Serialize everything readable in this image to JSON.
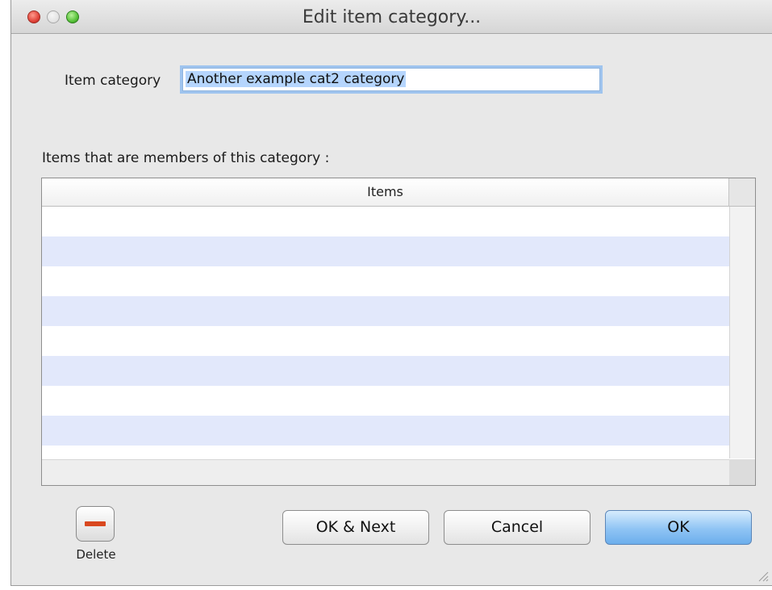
{
  "window": {
    "title": "Edit item category..."
  },
  "form": {
    "category_label": "Item category",
    "category_value": "Another example cat2 category",
    "members_label": "Items that are members of this category :"
  },
  "table": {
    "header": "Items",
    "rows": [
      "",
      "",
      "",
      "",
      "",
      "",
      "",
      ""
    ]
  },
  "buttons": {
    "delete_label": "Delete",
    "ok_next": "OK & Next",
    "cancel": "Cancel",
    "ok": "OK"
  },
  "colors": {
    "close": "#e0443a",
    "zoom": "#58c23a",
    "row_stripe": "#e2e8fb",
    "default_button": "#8fc4f4",
    "delete_minus": "#d9481f"
  },
  "icons": [
    "close-icon",
    "minimize-icon",
    "zoom-icon",
    "minus-icon",
    "resize-grip-icon"
  ]
}
